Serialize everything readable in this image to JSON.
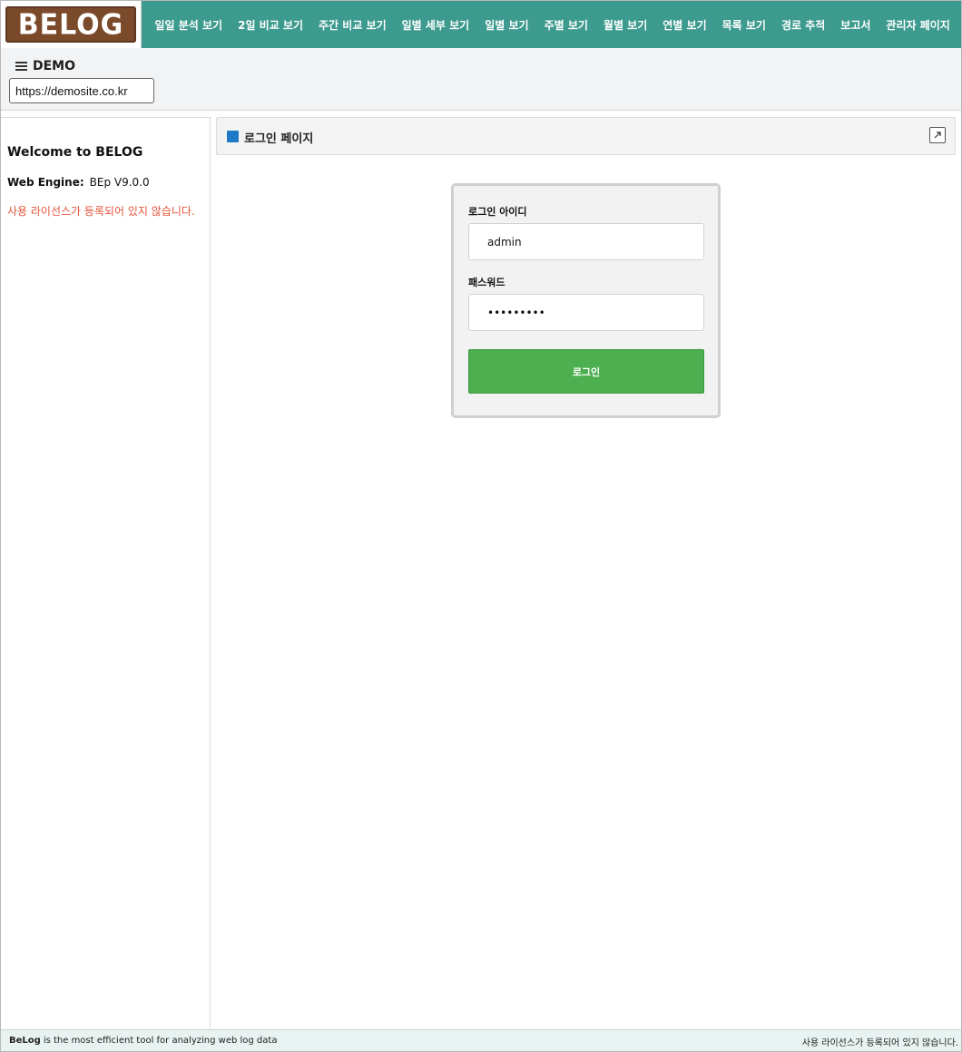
{
  "brand": {
    "logo_text": "BELOG"
  },
  "nav": [
    "일일 분석 보기",
    "2일 비교 보기",
    "주간 비교 보기",
    "일별 세부 보기",
    "일별 보기",
    "주별 보기",
    "월별 보기",
    "연별 보기",
    "목록 보기",
    "경로 추적",
    "보고서",
    "관리자 페이지"
  ],
  "site": {
    "title": "DEMO",
    "url": "https://demosite.co.kr"
  },
  "left_panel": {
    "welcome": "Welcome to BELOG",
    "engine_label": "Web Engine:",
    "engine_value": "BEp V9.0.0",
    "license_warning": "사용 라이선스가 등록되어 있지 않습니다."
  },
  "page": {
    "title": "로그인 페이지",
    "expand_icon": "expand-icon"
  },
  "login_form": {
    "id_label": "로그인 아이디",
    "id_value": "admin",
    "password_label": "패스워드",
    "password_value": "•••••••••",
    "submit_label": "로그인"
  },
  "footer": {
    "brand": "BeLog",
    "tagline": "is the most efficient tool for analyzing web log data",
    "license_notice": "사용 라이선스가 등록되어 있지 않습니다."
  },
  "colors": {
    "topbar": "#3d9a8e",
    "logo_bg": "#7a4a2a",
    "accent_blue": "#1e79c7",
    "button_green": "#4caf50",
    "warning_red": "#e2553b",
    "footer_bg": "#e8f3f1"
  }
}
